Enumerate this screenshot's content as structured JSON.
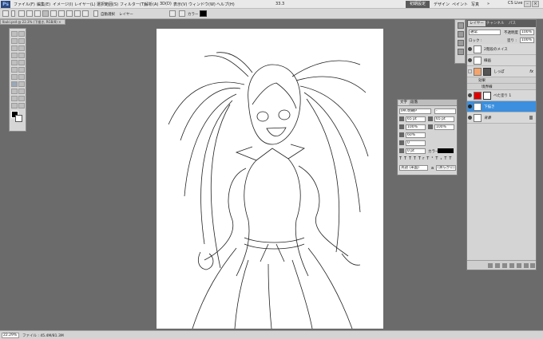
{
  "app": {
    "logo": "Ps"
  },
  "menus": [
    "ファイル(F)",
    "編集(E)",
    "イメージ(I)",
    "レイヤー(L)",
    "選択範囲(S)",
    "フィルター(T)",
    "解析(A)",
    "3D(D)",
    "表示(V)",
    "ウィンドウ(W)",
    "ヘルプ(H)"
  ],
  "topbar": {
    "zoom": "33.3",
    "workspaces": [
      "初期設定",
      "デザイン",
      "ペイント",
      "写真"
    ],
    "more": "»",
    "cs_live": "CS Live",
    "win_min": "–",
    "win_max": "□",
    "win_close": "×"
  },
  "options": {
    "auto_select": "自動選択",
    "auto_select_value": "レイヤー",
    "transform": "バウンディングボックスを表示",
    "color_label": "カラー :"
  },
  "document": {
    "tab_title": "Ibuki.psd @ 22.3% (下描き, RGB/8) ×"
  },
  "status": {
    "zoom": "22.29%",
    "file_info": "ファイル : 45.4M/81.3M"
  },
  "character_panel": {
    "tabs": [
      "文字",
      "段落"
    ],
    "font_family": "IPA 明朝P",
    "font_style": "-",
    "font_size": "65 pt",
    "leading": "65 pt",
    "vertical_scale": "100%",
    "horizontal_scale": "100%",
    "tracking": "60%",
    "kerning": "0",
    "baseline_shift": "0 pt",
    "color_label": "カラー :",
    "styles": [
      "T",
      "T",
      "TT",
      "Tr",
      "T¹",
      "T₁",
      "T",
      "T"
    ],
    "language": "英語 (米国)",
    "aa": "a",
    "aa_mode": "(滑らかに)"
  },
  "layers_panel": {
    "tabs": [
      "レイヤー",
      "チャンネル",
      "パス"
    ],
    "blend_mode": "通常",
    "opacity_label": "不透明度 :",
    "opacity": "100%",
    "lock_label": "ロック :",
    "fill_label": "塗り :",
    "fill": "100%",
    "layers": [
      {
        "name": "2階段のメイス",
        "selected": false,
        "visible": true,
        "thumb_color": "#ffffff"
      },
      {
        "name": "線画",
        "selected": false,
        "visible": true,
        "thumb_color": "#ffffff"
      },
      {
        "name": "しっぽ",
        "selected": false,
        "visible": false,
        "thumb_color": "#f4a46b",
        "fx": "fx"
      },
      {
        "name": "効果",
        "selected": false,
        "visible": true,
        "thumb_color": "",
        "effect": true
      },
      {
        "name": "境界線",
        "selected": false,
        "visible": true,
        "thumb_color": "",
        "effect": true
      },
      {
        "name": "べた塗り 1",
        "selected": false,
        "visible": true,
        "thumb_color": "#ff0000"
      },
      {
        "name": "下描き",
        "selected": true,
        "visible": true,
        "thumb_color": "#ffffff"
      },
      {
        "name": "背景",
        "selected": false,
        "visible": true,
        "thumb_color": "#ffffff"
      }
    ],
    "footer_icons": [
      "link-icon",
      "fx-icon",
      "mask-icon",
      "adjustment-icon",
      "folder-icon",
      "new-layer-icon",
      "trash-icon"
    ]
  },
  "colors": {
    "selection": "#3b8fde",
    "workspace_active": "#5a5a5a",
    "canvas_bg": "#6b6b6b"
  }
}
